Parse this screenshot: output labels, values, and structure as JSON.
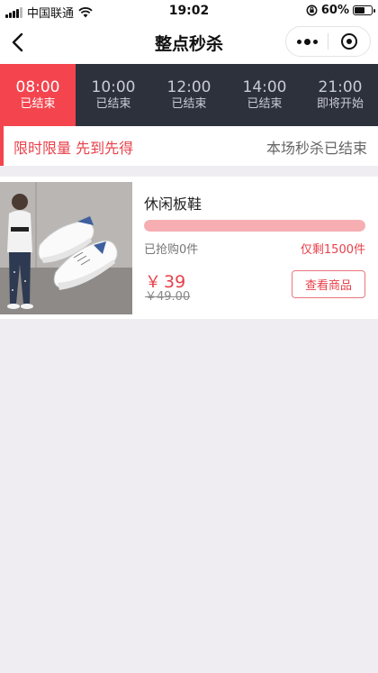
{
  "status_bar": {
    "carrier": "中国联通",
    "time": "19:02",
    "battery": "60%",
    "battery_level": 0.6
  },
  "nav": {
    "title": "整点秒杀",
    "back_icon": "back-arrow-icon",
    "more_icon": "more-dots-icon",
    "close_icon": "target-close-icon"
  },
  "tabs": [
    {
      "time": "08:00",
      "status": "已结束",
      "active": true
    },
    {
      "time": "10:00",
      "status": "已结束",
      "active": false
    },
    {
      "time": "12:00",
      "status": "已结束",
      "active": false
    },
    {
      "time": "14:00",
      "status": "已结束",
      "active": false
    },
    {
      "time": "21:00",
      "status": "即将开始",
      "active": false
    }
  ],
  "info_bar": {
    "left": "限时限量 先到先得",
    "right": "本场秒杀已结束"
  },
  "products": [
    {
      "name": "休闲板鞋",
      "progress": 0.0,
      "sold": "已抢购0件",
      "remaining": "仅剩1500件",
      "currency": "￥",
      "price": "39",
      "original_price": "￥49.00",
      "button": "查看商品"
    }
  ],
  "colors": {
    "accent": "#f4444e",
    "tab_bg": "#2c313c",
    "page_bg": "#efedf2",
    "progress": "#f6aeb2"
  }
}
